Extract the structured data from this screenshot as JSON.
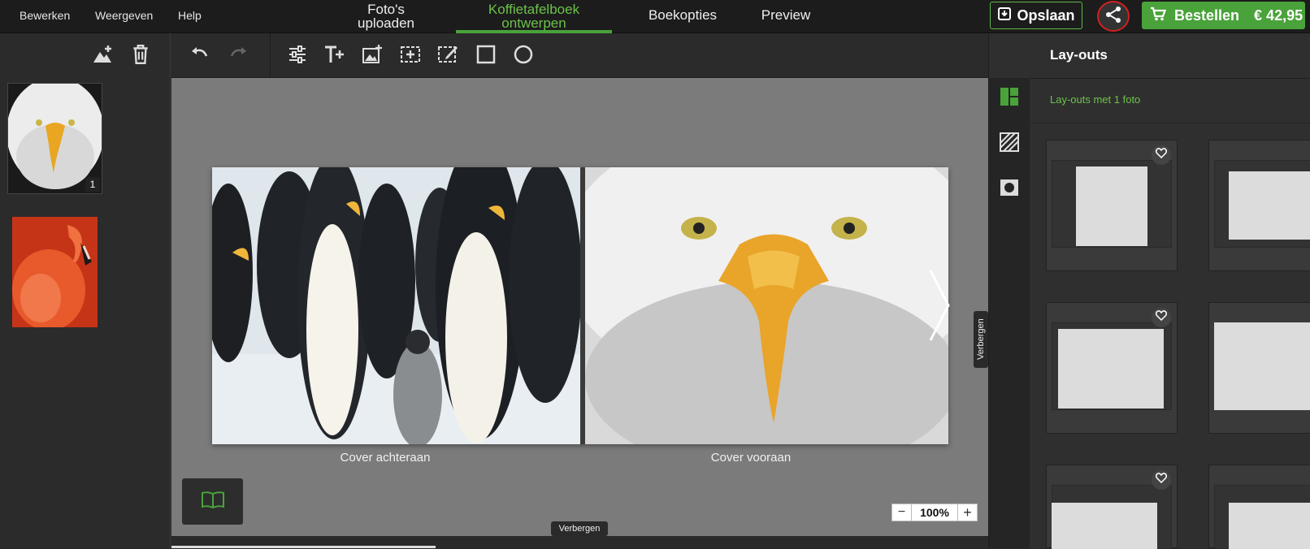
{
  "menu": {
    "edit": "Bewerken",
    "view": "Weergeven",
    "help": "Help"
  },
  "nav": {
    "upload_line1": "Foto's",
    "upload_line2": "uploaden",
    "design_line1": "Koffietafelboek",
    "design_line2": "ontwerpen",
    "options": "Boekopties",
    "preview": "Preview"
  },
  "actions": {
    "save": "Opslaan",
    "order": "Bestellen",
    "price": "€ 42,95"
  },
  "thumbnails": [
    {
      "badge": "1"
    }
  ],
  "spread": {
    "back_label": "Cover achteraan",
    "front_label": "Cover vooraan"
  },
  "hide_label": "Verbergen",
  "zoom": {
    "value": "100%",
    "minus": "−",
    "plus": "+"
  },
  "right_panel": {
    "title": "Lay-outs",
    "subtitle": "Lay-outs met 1 foto"
  },
  "colors": {
    "accent": "#4aa23b",
    "accent_text": "#6cc24a",
    "share_ring": "#d32020"
  }
}
